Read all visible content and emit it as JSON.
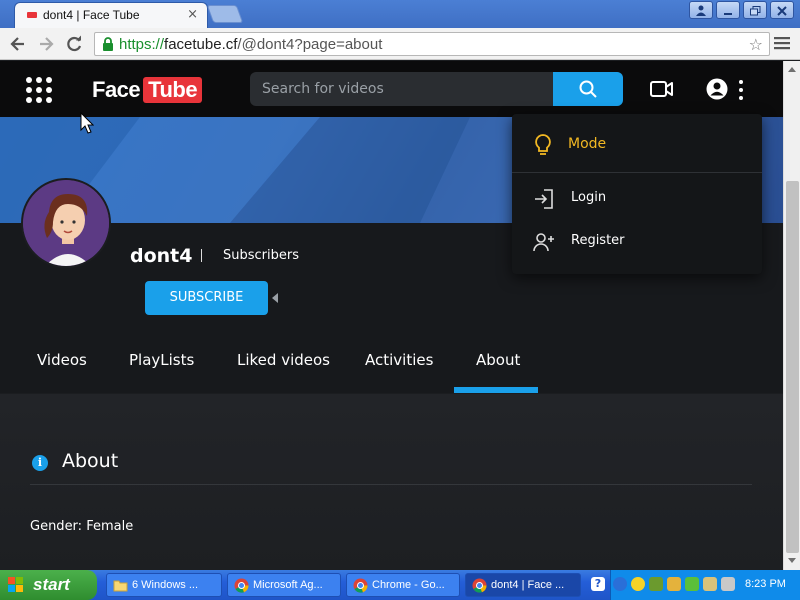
{
  "browser": {
    "tab_title": "dont4 | Face Tube",
    "tab_close": "×",
    "url_scheme": "https://",
    "url_host": "facetube.cf",
    "url_path": "/@dont4?page=about",
    "bookmark_star": "☆",
    "window_controls": [
      "person-icon",
      "minimize-icon",
      "restore-icon",
      "close-icon"
    ]
  },
  "site": {
    "logo_part1": "Face",
    "logo_part2": "Tube",
    "search_placeholder": "Search for videos",
    "brand_accent": "#1aa0ea",
    "logo_red": "#e8343a"
  },
  "profile": {
    "username": "dont4",
    "subscribers_label": "Subscribers",
    "subscribe_button": "SUBSCRIBE"
  },
  "tabs": [
    {
      "label": "Videos"
    },
    {
      "label": "PlayLists"
    },
    {
      "label": "Liked videos"
    },
    {
      "label": "Activities"
    },
    {
      "label": "About",
      "active": true
    }
  ],
  "about": {
    "title": "About",
    "gender": "Gender: Female"
  },
  "dropdown": {
    "mode_label": "Mode",
    "login_label": "Login",
    "register_label": "Register",
    "mode_color": "#f2b823"
  },
  "taskbar": {
    "start_label": "start",
    "tasks": [
      {
        "label": "6 Windows ...",
        "icon": "folder-icon"
      },
      {
        "label": "Microsoft Ag...",
        "icon": "chrome-icon"
      },
      {
        "label": "Chrome - Go...",
        "icon": "chrome-icon"
      },
      {
        "label": "dont4 | Face ...",
        "icon": "chrome-icon",
        "active": true
      }
    ],
    "clock": "8:23 PM"
  }
}
